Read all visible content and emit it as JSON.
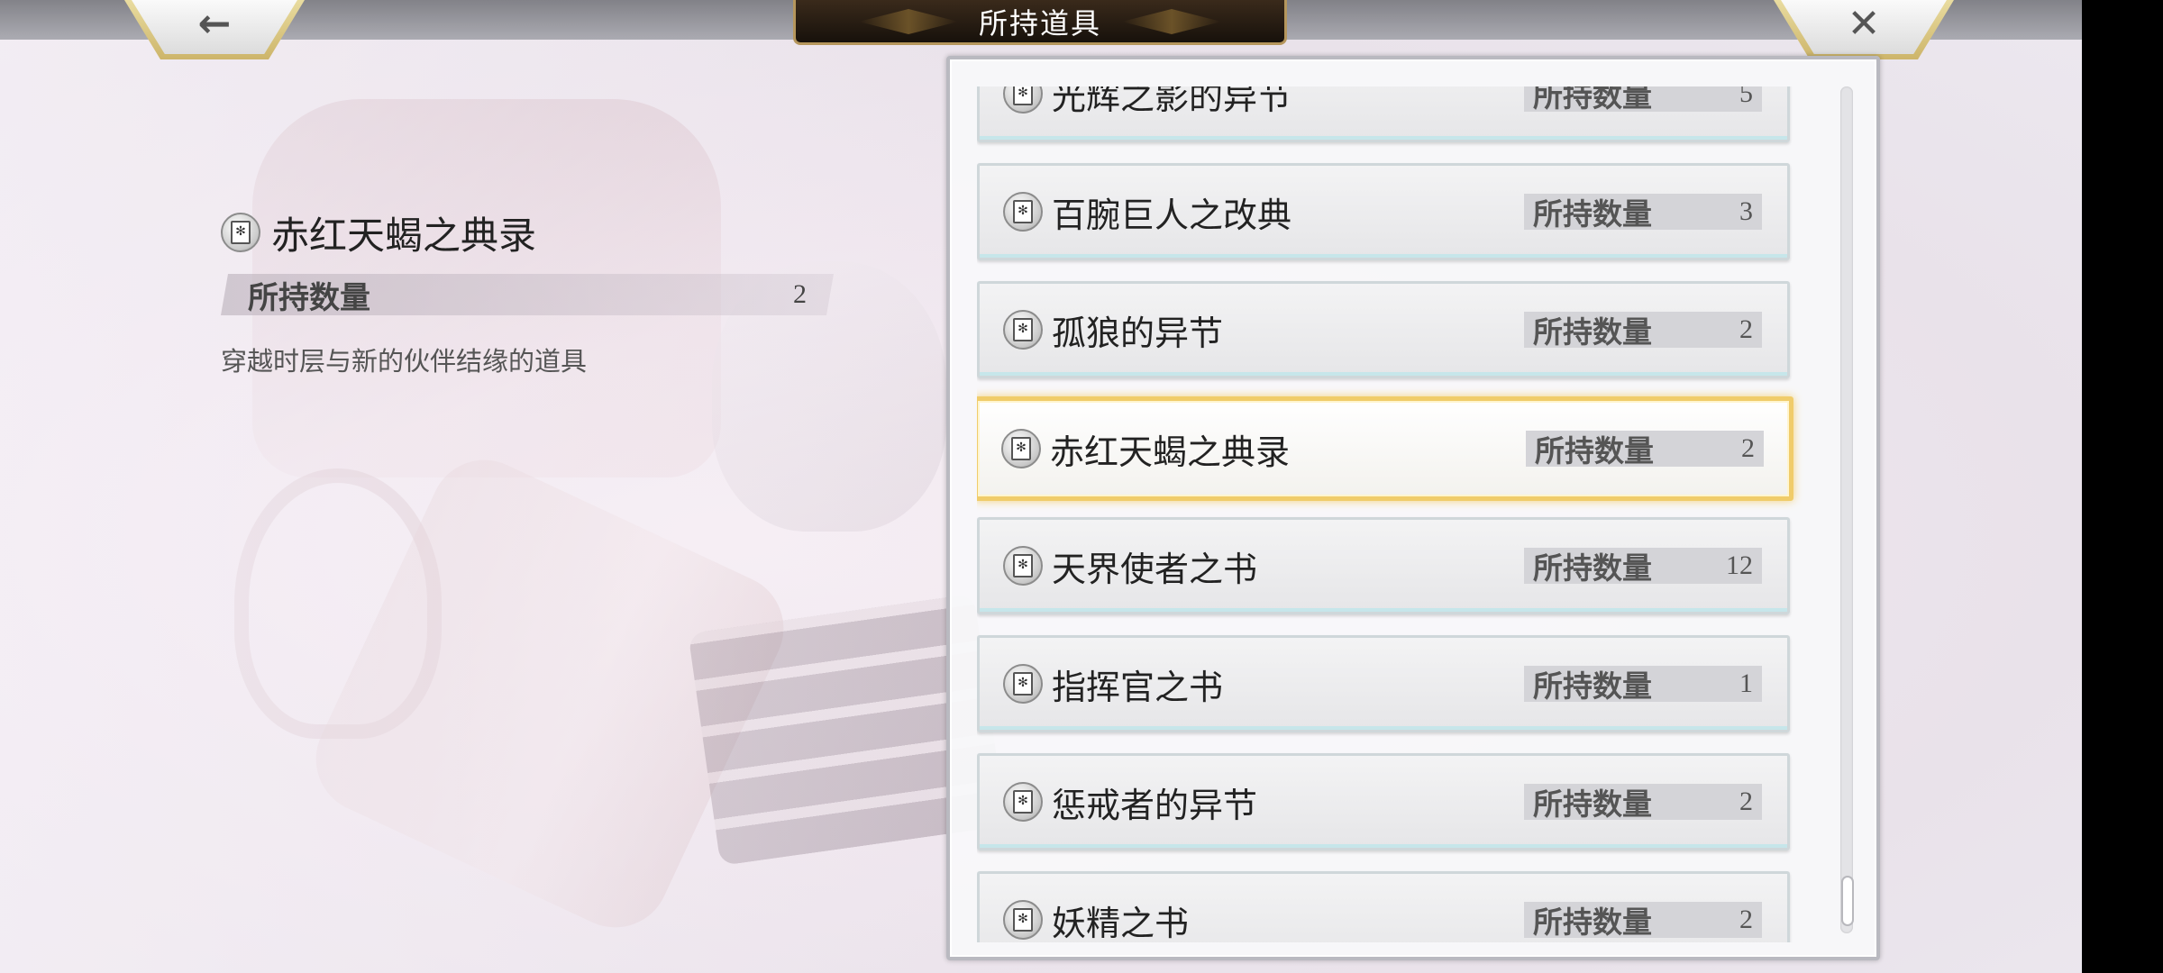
{
  "header": {
    "title": "所持道具",
    "back_icon": "←",
    "close_icon": "✕"
  },
  "detail": {
    "name": "赤红天蝎之典录",
    "count_label": "所持数量",
    "count_value": "2",
    "description": "穿越时层与新的伙伴结缘的道具",
    "icon": "book-icon"
  },
  "list": {
    "qty_label": "所持数量",
    "items": [
      {
        "name": "光辉之影的异节",
        "qty": "5"
      },
      {
        "name": "百腕巨人之改典",
        "qty": "3"
      },
      {
        "name": "孤狼的异节",
        "qty": "2"
      },
      {
        "name": "赤红天蝎之典录",
        "qty": "2",
        "selected": true
      },
      {
        "name": "天界使者之书",
        "qty": "12"
      },
      {
        "name": "指挥官之书",
        "qty": "1"
      },
      {
        "name": "惩戒者的异节",
        "qty": "2"
      },
      {
        "name": "妖精之书",
        "qty": "2"
      }
    ]
  },
  "colors": {
    "accent_gold": "#f0cc6a",
    "title_plate": "#17110b",
    "row_bg": "#e6e6e8"
  }
}
